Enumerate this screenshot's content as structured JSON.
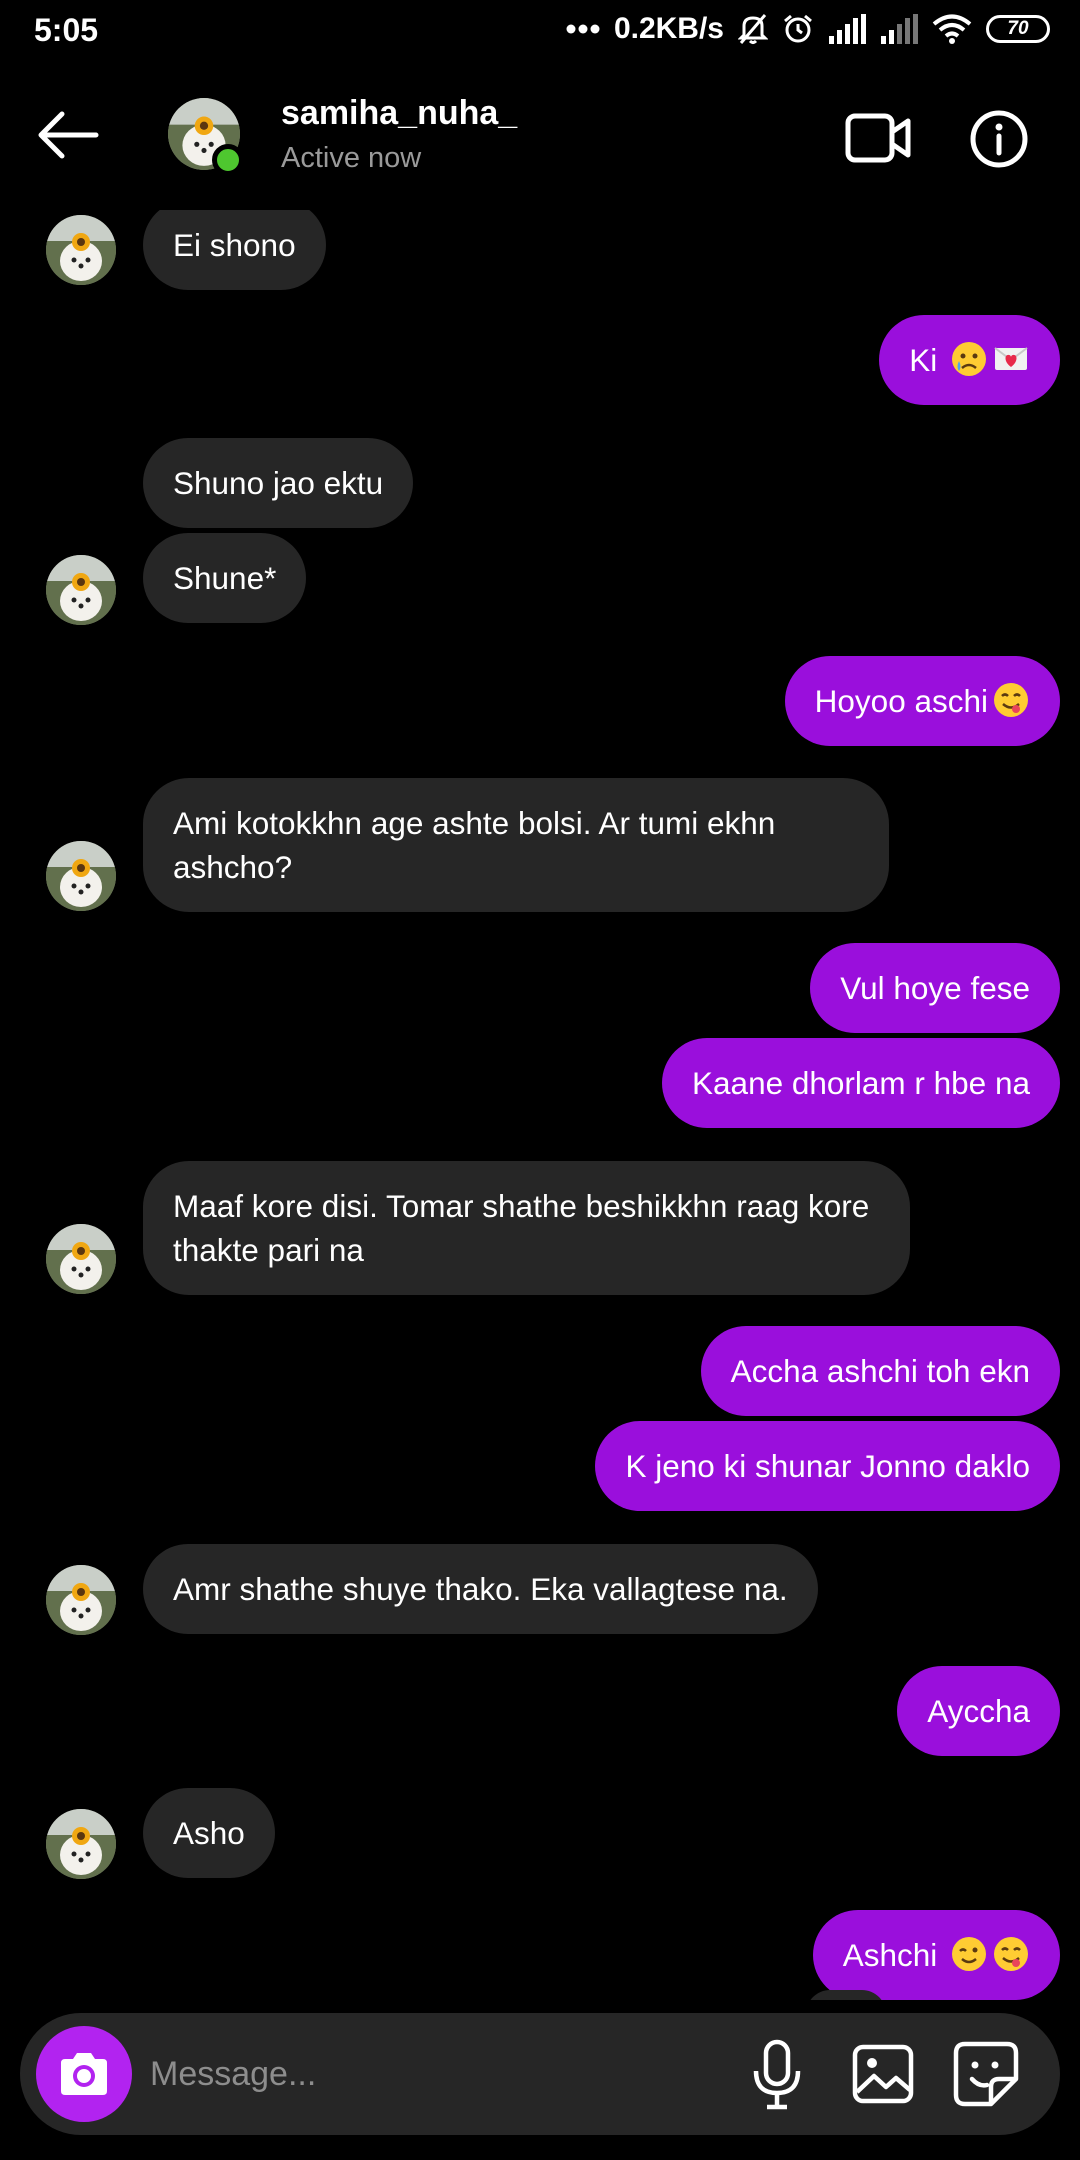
{
  "status_bar": {
    "time": "5:05",
    "network_speed": "0.2KB/s",
    "battery": "70",
    "icons": [
      "dots-icon",
      "mute-icon",
      "alarm-icon",
      "signal-icon",
      "signal-weak-icon",
      "wifi-icon",
      "battery-icon"
    ]
  },
  "header": {
    "contact_name": "samiha_nuha_",
    "status": "Active now",
    "online_color": "#4ec72f",
    "icons": [
      "back-arrow-icon",
      "video-camera-icon",
      "info-icon"
    ]
  },
  "conversation": {
    "incoming_color": "#262626",
    "outgoing_color": "#9a0fdc",
    "messages": [
      {
        "dir": "in",
        "text": "Ei shono"
      },
      {
        "dir": "out",
        "text": "Ki",
        "emoji": [
          "crying-face",
          "love-letter"
        ]
      },
      {
        "dir": "in",
        "text": "Shuno jao ektu"
      },
      {
        "dir": "in",
        "text": "Shune*"
      },
      {
        "dir": "out",
        "text": "Hoyoo aschi",
        "emoji": [
          "yum-face"
        ]
      },
      {
        "dir": "in",
        "text": "Ami kotokkhn age ashte bolsi. Ar tumi ekhn ashcho?"
      },
      {
        "dir": "out",
        "text": "Vul hoye fese"
      },
      {
        "dir": "out",
        "text": "Kaane dhorlam r hbe na"
      },
      {
        "dir": "in",
        "text": "Maaf kore disi. Tomar shathe beshikkhn raag kore thakte pari na"
      },
      {
        "dir": "out",
        "text": "Accha ashchi toh ekn"
      },
      {
        "dir": "out",
        "text": "K jeno ki shunar Jonno daklo"
      },
      {
        "dir": "in",
        "text": "Amr shathe shuye thako. Eka vallagtese na."
      },
      {
        "dir": "out",
        "text": "Ayccha"
      },
      {
        "dir": "in",
        "text": "Asho"
      },
      {
        "dir": "out",
        "text": "Ashchi",
        "emoji": [
          "wink-face",
          "yum-face"
        ]
      }
    ]
  },
  "composer": {
    "placeholder": "Message...",
    "camera_color": "#b223f0",
    "icons": [
      "camera-icon",
      "microphone-icon",
      "gallery-icon",
      "sticker-icon"
    ]
  }
}
